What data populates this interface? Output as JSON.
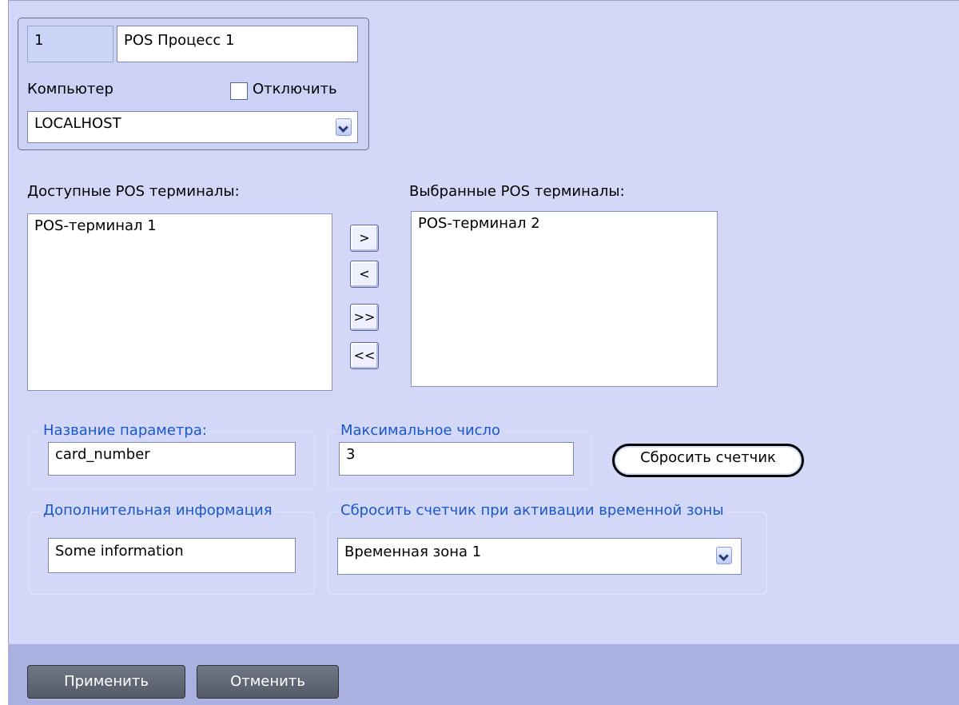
{
  "process": {
    "id": "1",
    "name": "POS Процесс 1",
    "computer_label": "Компьютер",
    "disable_label": "Отключить",
    "disable_checked": false,
    "computer_value": "LOCALHOST"
  },
  "terminals": {
    "available_label": "Доступные POS терминалы:",
    "available": [
      "POS-терминал 1"
    ],
    "selected_label": "Выбранные POS терминалы:",
    "selected": [
      "POS-терминал 2"
    ],
    "btn_add": ">",
    "btn_remove": "<",
    "btn_add_all": ">>",
    "btn_remove_all": "<<"
  },
  "param": {
    "title": "Название параметра:",
    "value": "card_number"
  },
  "max": {
    "title": "Максимальное число",
    "value": "3"
  },
  "reset_button": "Сбросить счетчик",
  "info": {
    "title": "Дополнительная информация",
    "value": "Some information"
  },
  "timezone": {
    "title": "Сбросить счетчик при активации временной зоны",
    "value": "Временная зона 1"
  },
  "footer": {
    "apply": "Применить",
    "cancel": "Отменить"
  }
}
